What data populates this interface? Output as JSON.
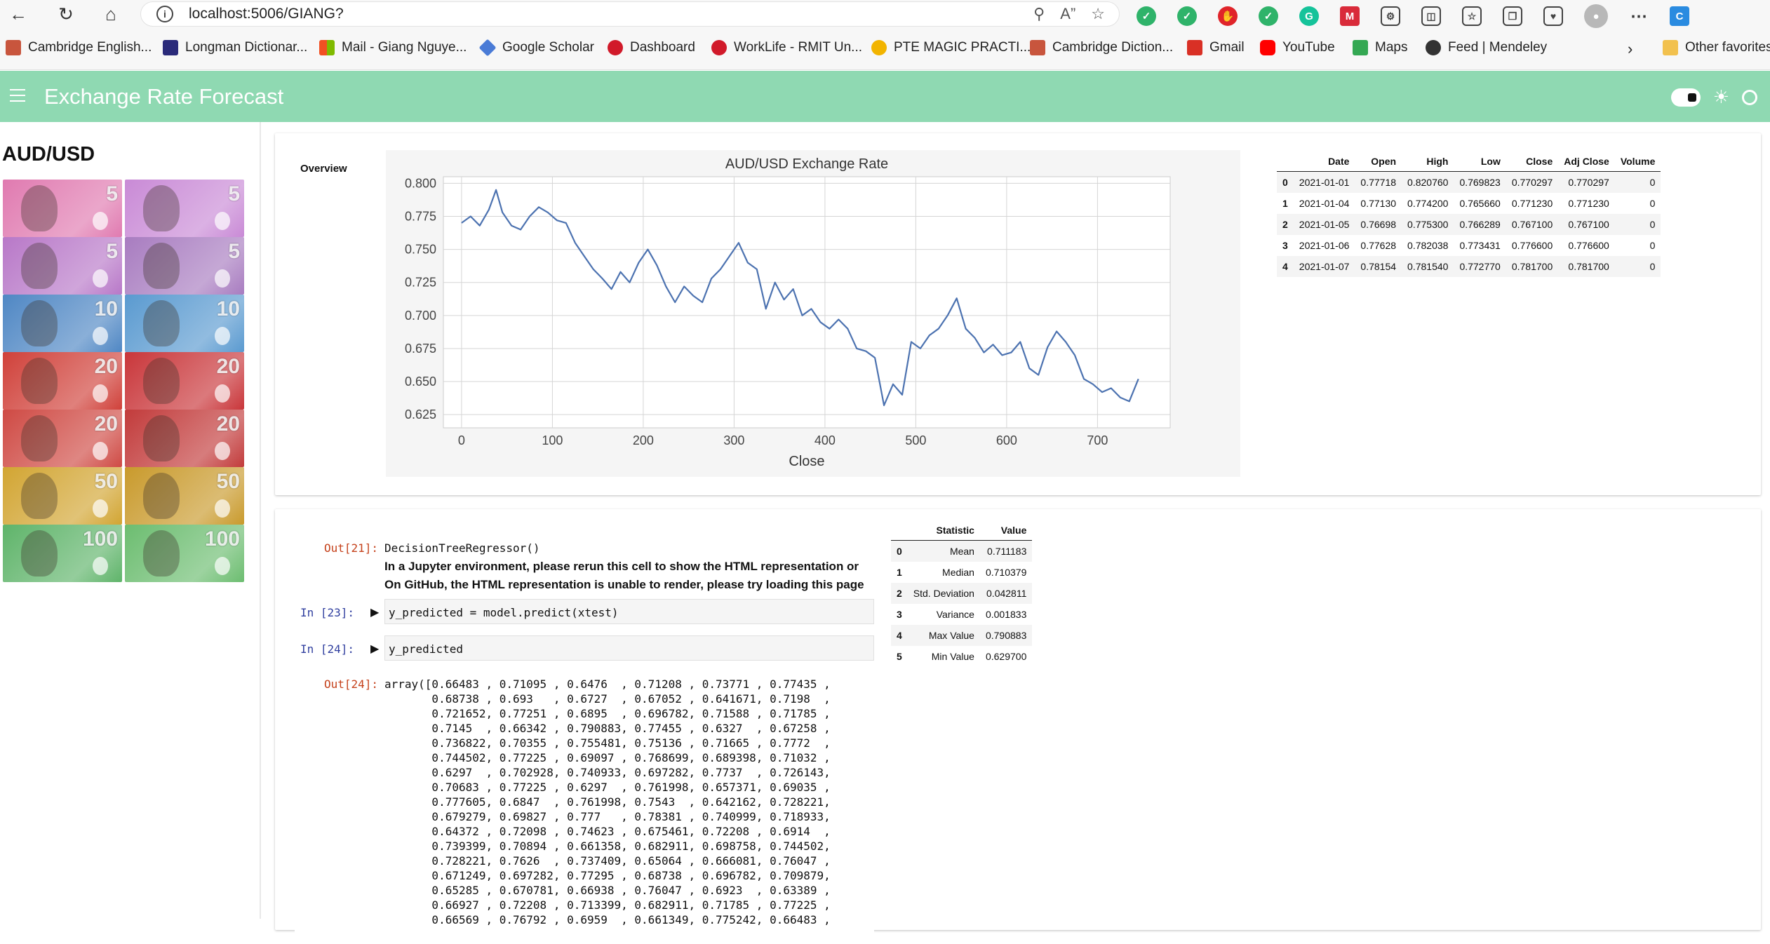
{
  "browser": {
    "url": "localhost:5006/GIANG?",
    "bookmarks": [
      {
        "label": "Cambridge English...",
        "color": "#c8553d"
      },
      {
        "label": "Longman Dictionar...",
        "color": "#2a2a7a"
      },
      {
        "label": "Mail - Giang Nguye...",
        "color": "#f25022"
      },
      {
        "label": "Google Scholar",
        "color": "#4a7bd6"
      },
      {
        "label": "Dashboard",
        "color": "#d11a2a"
      },
      {
        "label": "WorkLife - RMIT Un...",
        "color": "#d11a2a"
      },
      {
        "label": "PTE MAGIC PRACTI...",
        "color": "#f2b400"
      },
      {
        "label": "Cambridge Diction...",
        "color": "#c8553d"
      },
      {
        "label": "Gmail",
        "color": "#d93025"
      },
      {
        "label": "YouTube",
        "color": "#ff0000"
      },
      {
        "label": "Maps",
        "color": "#34a853"
      },
      {
        "label": "Feed | Mendeley",
        "color": "#333333"
      }
    ],
    "other_favorites": "Other favorites"
  },
  "app": {
    "title": "Exchange Rate Forecast",
    "accent": "#8fd9b2"
  },
  "sidebar": {
    "pair": "AUD/USD",
    "notes": [
      {
        "denom": "5",
        "color": "#e07ab0"
      },
      {
        "denom": "5",
        "color": "#c98ad6"
      },
      {
        "denom": "5",
        "color": "#b878c8"
      },
      {
        "denom": "5",
        "color": "#a87cc0"
      },
      {
        "denom": "10",
        "color": "#4f87c4"
      },
      {
        "denom": "10",
        "color": "#5a9ad0"
      },
      {
        "denom": "20",
        "color": "#d0413a"
      },
      {
        "denom": "20",
        "color": "#c9363a"
      },
      {
        "denom": "20",
        "color": "#cf4a44"
      },
      {
        "denom": "20",
        "color": "#c23b3b"
      },
      {
        "denom": "50",
        "color": "#d2a532"
      },
      {
        "denom": "50",
        "color": "#c99a2c"
      },
      {
        "denom": "100",
        "color": "#5fb46a"
      },
      {
        "denom": "100",
        "color": "#6cbd70"
      }
    ]
  },
  "overview_label": "Overview",
  "chart_data": {
    "type": "line",
    "title": "AUD/USD Exchange Rate",
    "xlabel": "Close",
    "ylabel": "",
    "xlim": [
      -20,
      780
    ],
    "ylim": [
      0.615,
      0.805
    ],
    "xticks": [
      0,
      100,
      200,
      300,
      400,
      500,
      600,
      700
    ],
    "yticks": [
      0.625,
      0.65,
      0.675,
      0.7,
      0.725,
      0.75,
      0.775,
      0.8
    ],
    "grid": true,
    "color": "#4c72b0",
    "series": [
      {
        "x": [
          0,
          10,
          20,
          30,
          38,
          45,
          55,
          65,
          75,
          85,
          95,
          105,
          115,
          125,
          135,
          145,
          155,
          165,
          175,
          185,
          195,
          205,
          215,
          225,
          235,
          245,
          255,
          265,
          275,
          285,
          295,
          305,
          315,
          325,
          335,
          345,
          355,
          365,
          375,
          385,
          395,
          405,
          415,
          425,
          435,
          445,
          455,
          465,
          475,
          485,
          495,
          505,
          515,
          525,
          535,
          545,
          555,
          565,
          575,
          585,
          595,
          605,
          615,
          625,
          635,
          645,
          655,
          665,
          675,
          685,
          695,
          705,
          715,
          725,
          735,
          745
        ],
        "y": [
          0.77,
          0.775,
          0.768,
          0.78,
          0.795,
          0.778,
          0.768,
          0.765,
          0.775,
          0.782,
          0.778,
          0.772,
          0.77,
          0.755,
          0.745,
          0.735,
          0.728,
          0.72,
          0.733,
          0.725,
          0.74,
          0.75,
          0.738,
          0.722,
          0.71,
          0.722,
          0.715,
          0.71,
          0.728,
          0.735,
          0.745,
          0.755,
          0.74,
          0.735,
          0.705,
          0.725,
          0.712,
          0.72,
          0.7,
          0.705,
          0.695,
          0.69,
          0.697,
          0.69,
          0.675,
          0.673,
          0.668,
          0.632,
          0.648,
          0.64,
          0.68,
          0.675,
          0.685,
          0.69,
          0.7,
          0.713,
          0.69,
          0.683,
          0.672,
          0.678,
          0.67,
          0.672,
          0.68,
          0.66,
          0.655,
          0.676,
          0.688,
          0.68,
          0.67,
          0.652,
          0.648,
          0.642,
          0.645,
          0.638,
          0.635,
          0.652
        ]
      }
    ]
  },
  "table1": {
    "columns": [
      "",
      "Date",
      "Open",
      "High",
      "Low",
      "Close",
      "Adj Close",
      "Volume"
    ],
    "rows": [
      [
        "0",
        "2021-01-01",
        "0.77718",
        "0.820760",
        "0.769823",
        "0.770297",
        "0.770297",
        "0"
      ],
      [
        "1",
        "2021-01-04",
        "0.77130",
        "0.774200",
        "0.765660",
        "0.771230",
        "0.771230",
        "0"
      ],
      [
        "2",
        "2021-01-05",
        "0.76698",
        "0.775300",
        "0.766289",
        "0.767100",
        "0.767100",
        "0"
      ],
      [
        "3",
        "2021-01-06",
        "0.77628",
        "0.782038",
        "0.773431",
        "0.776600",
        "0.776600",
        "0"
      ],
      [
        "4",
        "2021-01-07",
        "0.78154",
        "0.781540",
        "0.772770",
        "0.781700",
        "0.781700",
        "0"
      ]
    ]
  },
  "table2": {
    "columns": [
      "",
      "Statistic",
      "Value"
    ],
    "rows": [
      [
        "0",
        "Mean",
        "0.711183"
      ],
      [
        "1",
        "Median",
        "0.710379"
      ],
      [
        "2",
        "Std. Deviation",
        "0.042811"
      ],
      [
        "3",
        "Variance",
        "0.001833"
      ],
      [
        "4",
        "Max Value",
        "0.790883"
      ],
      [
        "5",
        "Min Value",
        "0.629700"
      ]
    ]
  },
  "notebook": {
    "out21_prompt": "Out[21]:",
    "out21_text": "DecisionTreeRegressor()",
    "warn1": "In a Jupyter environment, please rerun this cell to show the HTML representation or",
    "warn2": "On GitHub, the HTML representation is unable to render, please try loading this page",
    "in23_prompt": "In [23]:",
    "in23_code": "y_predicted = model.predict(xtest)",
    "in24_prompt": "In [24]:",
    "in24_code": "y_predicted",
    "out24_prompt": "Out[24]:",
    "array_lines": [
      "array([0.66483 , 0.71095 , 0.6476  , 0.71208 , 0.73771 , 0.77435 ,",
      "       0.68738 , 0.693   , 0.6727  , 0.67052 , 0.641671, 0.7198  ,",
      "       0.721652, 0.77251 , 0.6895  , 0.696782, 0.71588 , 0.71785 ,",
      "       0.7145  , 0.66342 , 0.790883, 0.77455 , 0.6327  , 0.67258 ,",
      "       0.736822, 0.70355 , 0.755481, 0.75136 , 0.71665 , 0.7772  ,",
      "       0.744502, 0.77225 , 0.69097 , 0.768699, 0.689398, 0.71032 ,",
      "       0.6297  , 0.702928, 0.740933, 0.697282, 0.7737  , 0.726143,",
      "       0.70683 , 0.77225 , 0.6297  , 0.761998, 0.657371, 0.69035 ,",
      "       0.777605, 0.6847  , 0.761998, 0.7543  , 0.642162, 0.728221,",
      "       0.679279, 0.69827 , 0.777   , 0.78381 , 0.740999, 0.718933,",
      "       0.64372 , 0.72098 , 0.74623 , 0.675461, 0.72208 , 0.6914  ,",
      "       0.739399, 0.70894 , 0.661358, 0.682911, 0.698758, 0.744502,",
      "       0.728221, 0.7626  , 0.737409, 0.65064 , 0.666081, 0.76047 ,",
      "       0.671249, 0.697282, 0.77295 , 0.68738 , 0.696782, 0.709879,",
      "       0.65285 , 0.670781, 0.66938 , 0.76047 , 0.6923  , 0.63389 ,",
      "       0.66927 , 0.72208 , 0.713399, 0.682911, 0.71785 , 0.77225 ,",
      "       0.66569 , 0.76792 , 0.6959  , 0.661349, 0.775242, 0.66483 ,"
    ]
  }
}
